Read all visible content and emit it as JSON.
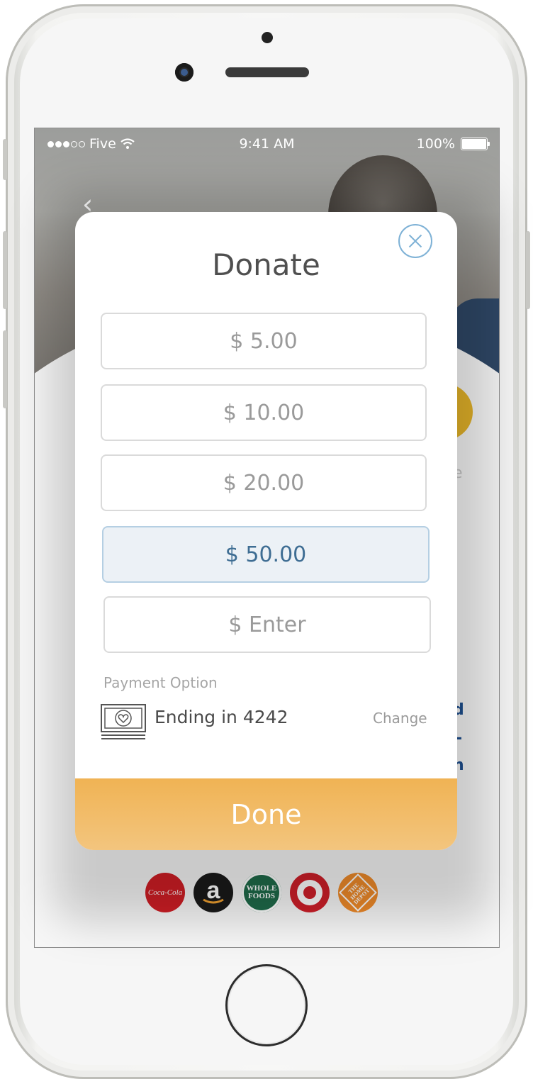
{
  "status_bar": {
    "carrier": "Five",
    "time": "9:41 AM",
    "battery": "100%"
  },
  "modal": {
    "title": "Donate",
    "amounts": [
      "$  5.00",
      "$ 10.00",
      "$ 20.00",
      "$ 50.00"
    ],
    "selected_amount_index": 3,
    "custom_amount_placeholder": "$ Enter",
    "payment": {
      "label": "Payment Option",
      "card_text": "Ending in 4242",
      "change_label": "Change"
    },
    "done_label": "Done"
  },
  "background": {
    "partial_text_right": [
      "e",
      "d",
      "-",
      "n"
    ]
  },
  "logos": [
    {
      "name": "coca-cola",
      "text": "Coca-Cola"
    },
    {
      "name": "amazon",
      "text": "a"
    },
    {
      "name": "whole-foods",
      "text": "WHOLE FOODS"
    },
    {
      "name": "target",
      "text": ""
    },
    {
      "name": "home-depot",
      "text": "THE HOME DEPOT"
    }
  ],
  "colors": {
    "accent_orange": "#f0b354",
    "selected_blue": "#3e6d93",
    "close_blue": "#7fb2d6"
  }
}
